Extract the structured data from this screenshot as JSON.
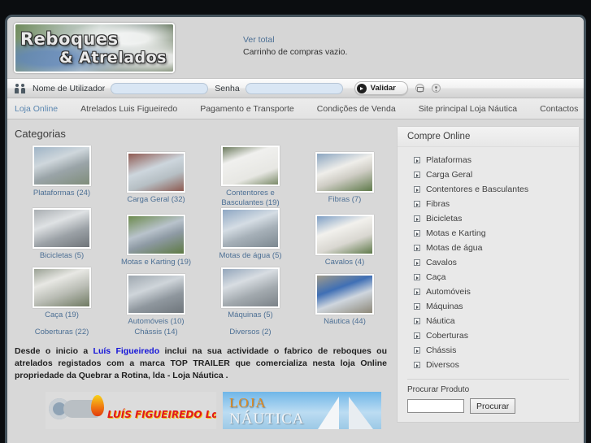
{
  "header": {
    "logo_line1": "Reboques",
    "logo_line2": "& Atrelados",
    "cart_link": "Ver total",
    "cart_status": "Carrinho de compras vazio."
  },
  "login": {
    "user_label": "Nome de Utilizador",
    "user_value": "",
    "user_placeholder": "",
    "pass_label": "Senha",
    "pass_value": "",
    "pass_placeholder": "",
    "submit_label": "Validar",
    "icons": [
      "users-icon",
      "envelope-icon",
      "user-icon"
    ]
  },
  "nav": {
    "items": [
      {
        "label": "Loja Online",
        "active": true
      },
      {
        "label": "Atrelados Luis Figueiredo",
        "active": false
      },
      {
        "label": "Pagamento e Transporte",
        "active": false
      },
      {
        "label": "Condições de Venda",
        "active": false
      },
      {
        "label": "Site principal Loja Náutica",
        "active": false
      },
      {
        "label": "Contactos",
        "active": false
      }
    ]
  },
  "main": {
    "title": "Categorias",
    "categories": [
      {
        "label": "Plataformas (24)",
        "thumb": "t1",
        "offset": false
      },
      {
        "label": "Carga Geral (32)",
        "thumb": "t2",
        "offset": true
      },
      {
        "label": "Contentores e Basculantes (19)",
        "thumb": "t3",
        "offset": false
      },
      {
        "label": "Fibras (7)",
        "thumb": "t4",
        "offset": true
      },
      {
        "label": "Bicicletas (5)",
        "thumb": "t5",
        "offset": false
      },
      {
        "label": "Motas e Karting (19)",
        "thumb": "t6",
        "offset": true
      },
      {
        "label": "Motas de água (5)",
        "thumb": "t7",
        "offset": false
      },
      {
        "label": "Cavalos (4)",
        "thumb": "t8",
        "offset": true
      },
      {
        "label": "Caça (19)",
        "thumb": "t9",
        "offset": false
      },
      {
        "label": "Automóveis (10)",
        "thumb": "t10",
        "offset": true
      },
      {
        "label": "Máquinas (5)",
        "thumb": "t11",
        "offset": false
      },
      {
        "label": "Náutica (44)",
        "thumb": "t12",
        "offset": true
      }
    ],
    "extra_categories": [
      "Coberturas (22)",
      "Chássis (14)",
      "Diversos (2)",
      ""
    ],
    "blurb_pre": "Desde o inicio a ",
    "blurb_link": "Luís Figueiredo",
    "blurb_post": " inclui na sua actividade o fabrico de reboques ou atrelados registados com a marca TOP TRAILER que comercializa nesta loja Online propriedade da Quebrar a Rotina, lda - Loja Náutica ."
  },
  "banners": {
    "left_text": "LUÍS FIGUEIREDO Lda",
    "right_line1": "LOJA",
    "right_line2": "NÁUTICA"
  },
  "sidebar": {
    "panel_title": "Compre Online",
    "items": [
      {
        "label": "Plataformas"
      },
      {
        "label": "Carga Geral"
      },
      {
        "label": "Contentores e Basculantes"
      },
      {
        "label": "Fibras"
      },
      {
        "label": "Bicicletas"
      },
      {
        "label": "Motas e Karting"
      },
      {
        "label": "Motas de água"
      },
      {
        "label": "Cavalos"
      },
      {
        "label": "Caça"
      },
      {
        "label": "Automóveis"
      },
      {
        "label": "Máquinas"
      },
      {
        "label": "Náutica"
      },
      {
        "label": "Coberturas"
      },
      {
        "label": "Chássis"
      },
      {
        "label": "Diversos"
      }
    ],
    "search_label": "Procurar Produto",
    "search_value": "",
    "search_placeholder": "",
    "search_button": "Procurar"
  },
  "colors": {
    "frame_border": "#44525c",
    "page_bg": "#0b0d10",
    "content_bg": "#d8d8d8",
    "link_blue": "#4c6f94",
    "blurb_link": "#1414d8"
  }
}
